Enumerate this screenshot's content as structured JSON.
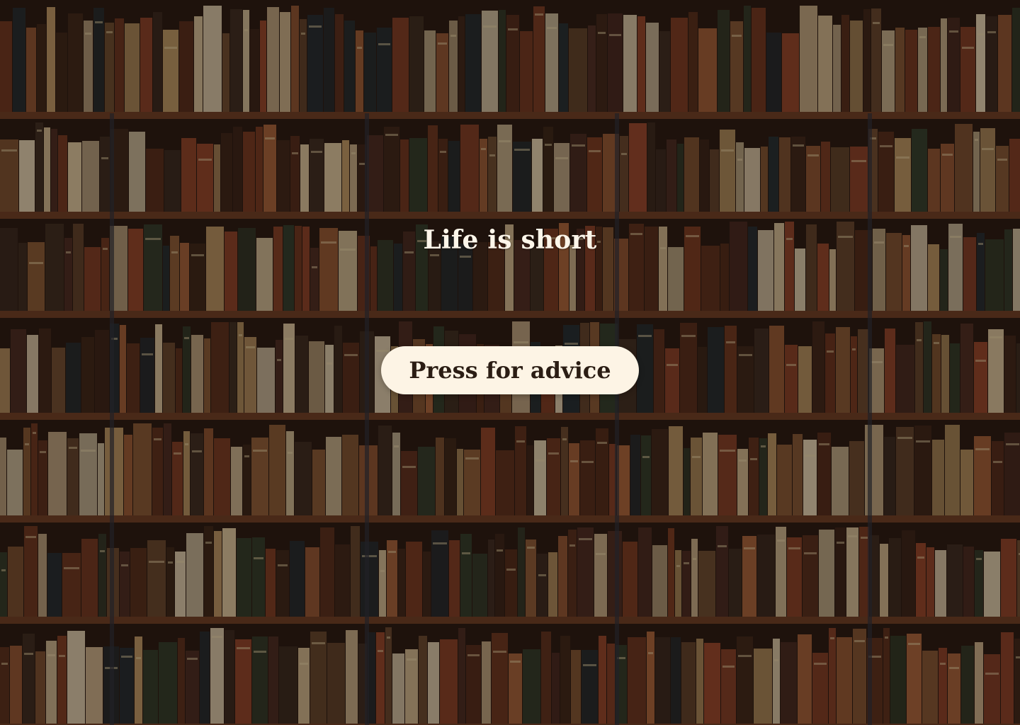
{
  "background": {
    "image": "bookshelf-photo",
    "overlay_color": "#140c08"
  },
  "main": {
    "headline": "Life is short",
    "advice_button_label": "Press for advice"
  },
  "colors": {
    "headline_text": "#fdf6ea",
    "button_bg": "#fdf4e5",
    "button_text": "#2b1d14"
  }
}
